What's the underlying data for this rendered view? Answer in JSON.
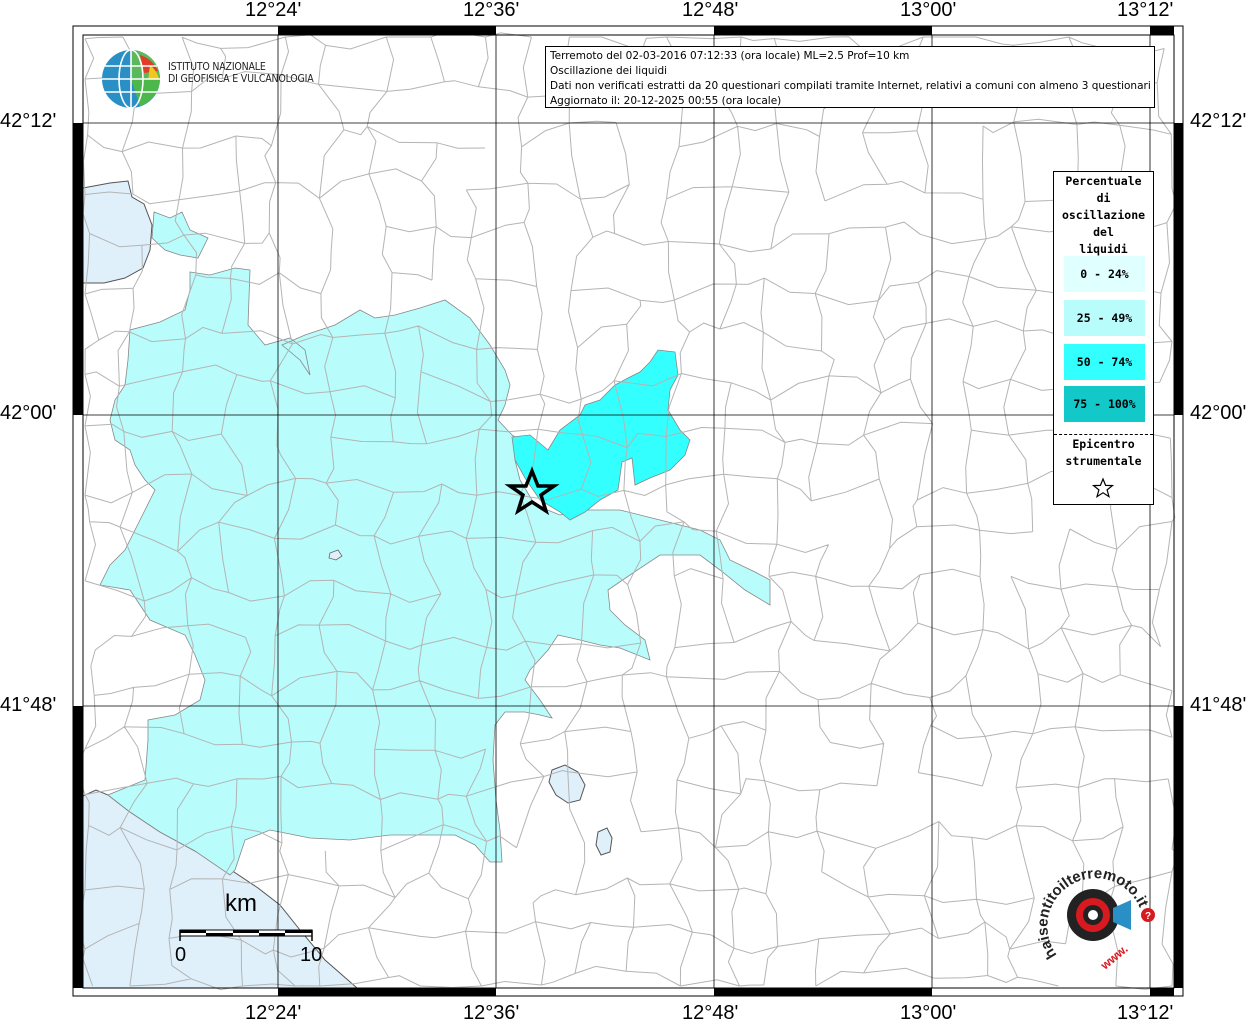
{
  "map": {
    "top_labels": [
      "12°24'",
      "12°36'",
      "12°48'",
      "13°00'",
      "13°12'"
    ],
    "bottom_labels": [
      "12°24'",
      "12°36'",
      "12°48'",
      "13°00'",
      "13°12'"
    ],
    "left_labels": [
      "42°12'",
      "42°00'",
      "41°48'"
    ],
    "right_labels": [
      "42°12'",
      "42°00'",
      "41°48'"
    ]
  },
  "logo": {
    "line1": "ISTITUTO NAZIONALE",
    "line2": "DI GEOFISICA E VULCANOLOGIA"
  },
  "info": {
    "line1": "Terremoto del 02-03-2016 07:12:33 (ora locale) ML=2.5 Prof=10 km",
    "line2": "Oscillazione dei liquidi",
    "line3": "Dati non verificati estratti da 20 questionari compilati tramite Internet, relativi a comuni con almeno 3 questionari.",
    "line4": "Aggiornato il: 20-12-2025 00:55 (ora locale)"
  },
  "legend": {
    "title_lines": [
      "Percentuale",
      "di",
      "oscillazione",
      "del",
      "liquidi"
    ],
    "classes": [
      {
        "label": "0 - 24%",
        "color": "#e0ffff"
      },
      {
        "label": "25 - 49%",
        "color": "#b9fcfc"
      },
      {
        "label": "50 - 74%",
        "color": "#33ffff"
      },
      {
        "label": "75 - 100%",
        "color": "#12c8c8"
      }
    ],
    "epicenter_lines": [
      "Epicentro",
      "strumentale"
    ]
  },
  "scale": {
    "unit": "km",
    "min_label": "0",
    "max_label": "10"
  },
  "watermark": {
    "text": "haisentitoilterremoto.it",
    "url": "www."
  },
  "colors": {
    "sea": "#dff0fb",
    "region_25_49": "#b9fcfc",
    "region_50_74": "#33ffff",
    "boundary": "#b4b4b4",
    "grid": "#000000"
  }
}
